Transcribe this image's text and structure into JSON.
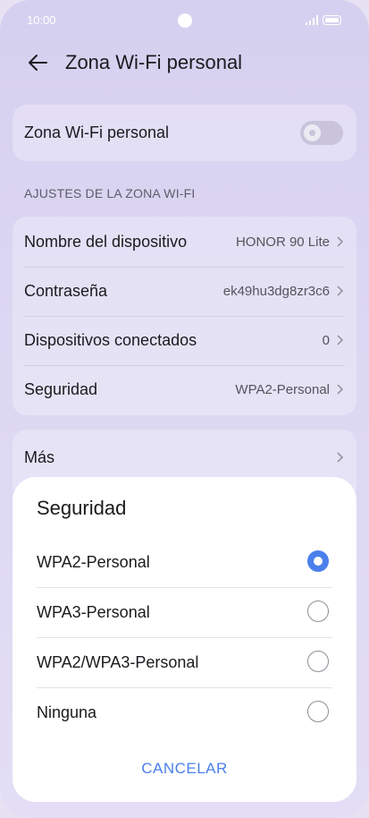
{
  "status_bar": {
    "time": "10:00"
  },
  "header": {
    "title": "Zona Wi-Fi personal"
  },
  "hotspot": {
    "label": "Zona Wi-Fi personal",
    "enabled": false
  },
  "section": {
    "title": "AJUSTES DE LA ZONA WI-FI"
  },
  "settings": [
    {
      "label": "Nombre del dispositivo",
      "value": "HONOR 90 Lite"
    },
    {
      "label": "Contraseña",
      "value": "ek49hu3dg8zr3c6"
    },
    {
      "label": "Dispositivos conectados",
      "value": "0"
    },
    {
      "label": "Seguridad",
      "value": "WPA2-Personal"
    }
  ],
  "more": {
    "label": "Más"
  },
  "sheet": {
    "title": "Seguridad",
    "options": [
      {
        "label": "WPA2-Personal",
        "selected": true
      },
      {
        "label": "WPA3-Personal",
        "selected": false
      },
      {
        "label": "WPA2/WPA3-Personal",
        "selected": false
      },
      {
        "label": "Ninguna",
        "selected": false
      }
    ],
    "cancel_label": "CANCELAR"
  },
  "colors": {
    "accent": "#4b80ec",
    "background": "#dcd7f2"
  }
}
